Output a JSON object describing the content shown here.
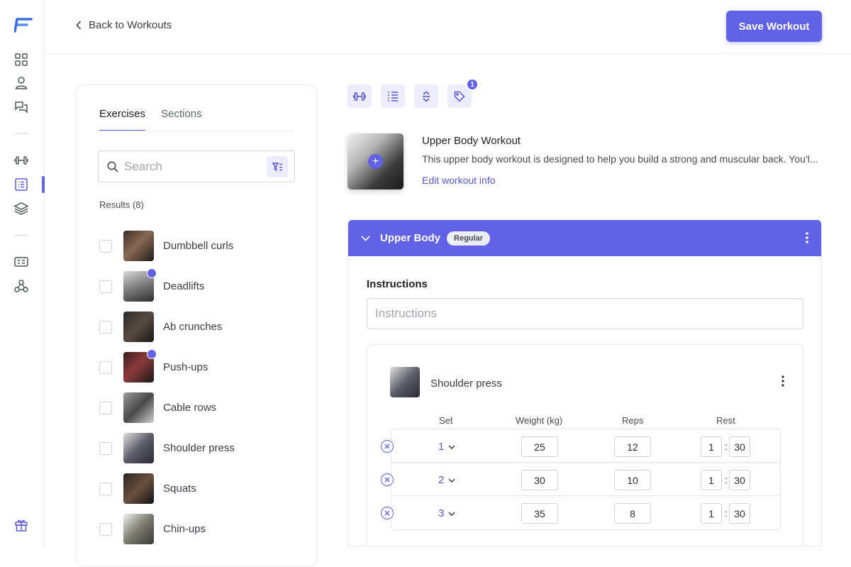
{
  "header": {
    "back_label": "Back to Workouts",
    "save_label": "Save Workout"
  },
  "sidebar": {
    "icons": [
      "dashboard-icon",
      "user-icon",
      "chat-icon",
      "dumbbell-icon",
      "list-icon",
      "layers-icon",
      "card-icon",
      "network-icon",
      "gift-icon"
    ],
    "active": "list-icon"
  },
  "library": {
    "tabs": [
      {
        "label": "Exercises",
        "active": true
      },
      {
        "label": "Sections",
        "active": false
      }
    ],
    "search_placeholder": "Search",
    "results_label": "Results (8)",
    "exercises": [
      {
        "name": "Dumbbell curls",
        "video": false
      },
      {
        "name": "Deadlifts",
        "video": true
      },
      {
        "name": "Ab crunches",
        "video": false
      },
      {
        "name": "Push-ups",
        "video": true
      },
      {
        "name": "Cable rows",
        "video": false
      },
      {
        "name": "Shoulder press",
        "video": false
      },
      {
        "name": "Squats",
        "video": false
      },
      {
        "name": "Chin-ups",
        "video": false
      }
    ]
  },
  "toolbar": {
    "tag_count": "1"
  },
  "workout": {
    "title": "Upper Body Workout",
    "description": "This upper body workout is designed to help you build a strong and muscular back. You'l...",
    "edit_label": "Edit workout info"
  },
  "section": {
    "name": "Upper Body",
    "type_badge": "Regular",
    "instructions_label": "Instructions",
    "instructions_placeholder": "Instructions",
    "exercise": {
      "name": "Shoulder press",
      "columns": {
        "set": "Set",
        "weight": "Weight (kg)",
        "reps": "Reps",
        "rest": "Rest"
      },
      "sets": [
        {
          "set": "1",
          "weight": "25",
          "reps": "12",
          "rest_min": "1",
          "rest_sec": "30"
        },
        {
          "set": "2",
          "weight": "30",
          "reps": "10",
          "rest_min": "1",
          "rest_sec": "30"
        },
        {
          "set": "3",
          "weight": "35",
          "reps": "8",
          "rest_min": "1",
          "rest_sec": "30"
        }
      ]
    }
  },
  "colors": {
    "accent": "#6262e6",
    "accent_light": "#ececfb"
  }
}
